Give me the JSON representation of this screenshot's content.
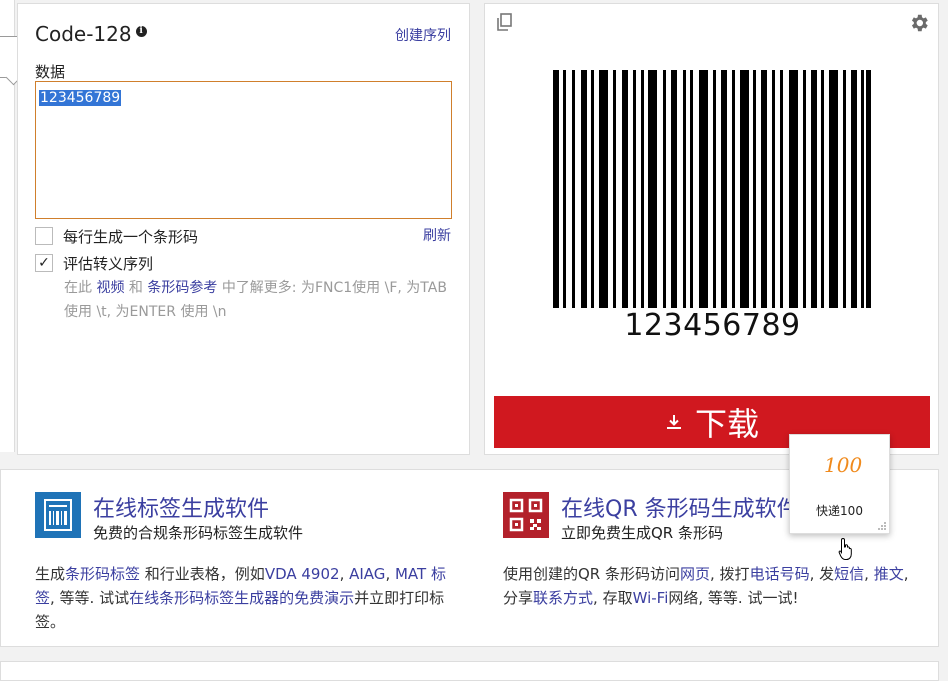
{
  "generator": {
    "title": "Code-128",
    "create_sequence": "创建序列",
    "data_label": "数据",
    "data_value": "123456789",
    "option_one_per_line": "每行生成一个条形码",
    "refresh": "刷新",
    "option_escape": "评估转义序列",
    "hint_prefix": "在此",
    "hint_video": "视频",
    "hint_and": "和",
    "hint_reference": "条形码参考",
    "hint_rest": "中了解更多: 为FNC1使用 \\F, 为TAB使用 \\t, 为ENTER 使用 \\n"
  },
  "preview": {
    "barcode_text": "123456789",
    "download_label": "下载",
    "icons": {
      "copy": "copy-icon",
      "settings": "gear-icon",
      "download": "download-icon"
    },
    "accent_color": "#d0181f"
  },
  "promo_label": {
    "title": "在线标签生成软件",
    "subtitle": "免费的合规条形码标签生成软件",
    "d1": "生成",
    "d2": "条形码标签",
    "d3": " 和行业表格，例如",
    "d4": "VDA 4902",
    "d5": ", ",
    "d6": "AIAG",
    "d7": ", ",
    "d8": "MAT 标签",
    "d9": ", 等等. 试试",
    "d10": "在线条形码标签生成器的免费演示",
    "d11": "并立即打印标签。"
  },
  "promo_qr": {
    "title": "在线QR 条形码生成软件",
    "subtitle": "立即免费生成QR 条形码",
    "d1": "使用创建的QR 条形码访问",
    "d2": "网页",
    "d3": ", 拨打",
    "d4": "电话号码",
    "d5": ", 发",
    "d6": "短信",
    "d7": ", ",
    "d8": "推文",
    "d9": ", 分享",
    "d10": "联系方式",
    "d11": ", 存取",
    "d12": "Wi-Fi",
    "d13": "网络, 等等. 试一试!"
  },
  "popup": {
    "logo_text": "100",
    "label": "快递100",
    "logo_color": "#f08a1c"
  }
}
